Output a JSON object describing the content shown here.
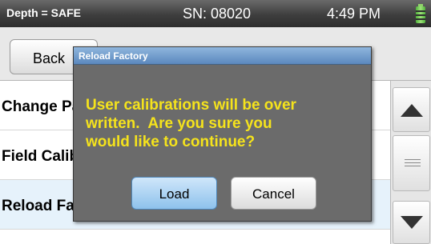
{
  "status_bar": {
    "depth": "Depth = SAFE",
    "serial": "SN: 08020",
    "time": "4:49 PM",
    "battery_icon": "battery-icon",
    "battery_color": "#5cc43f"
  },
  "toolbar": {
    "back_label": "Back"
  },
  "list": {
    "items": [
      {
        "label": "Change Password"
      },
      {
        "label": "Field Calibration"
      },
      {
        "label": "Reload Factory"
      }
    ],
    "selected_color": "#e6f2fb"
  },
  "scrollbar": {
    "up_icon": "up-arrow-icon",
    "grip_icon": "grip-icon",
    "down_icon": "down-arrow-icon"
  },
  "dialog": {
    "title": "Reload Factory",
    "message_lines": [
      "User calibrations will be over",
      "written.  Are you sure you",
      "would like to continue?"
    ],
    "message_color": "#f5e31c",
    "load_label": "Load",
    "cancel_label": "Cancel"
  }
}
